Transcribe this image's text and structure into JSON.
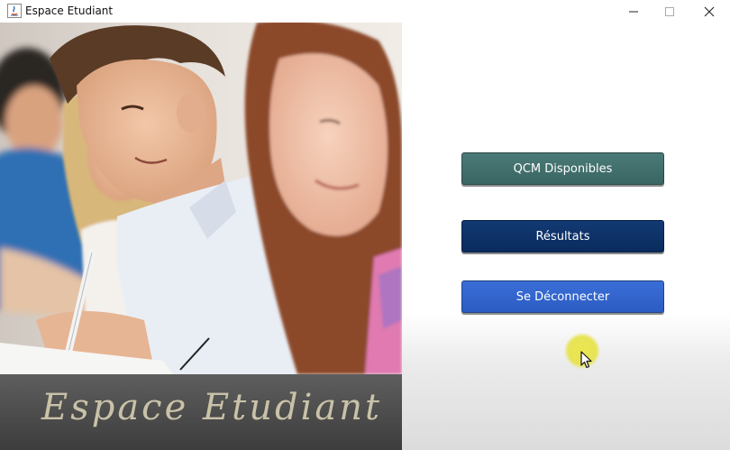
{
  "window": {
    "title": "Espace Etudiant",
    "controls": [
      "minimize-icon",
      "maximize-icon",
      "close-icon"
    ]
  },
  "left_panel": {
    "banner_text": "Espace Etudiant"
  },
  "menu": {
    "qcm_label": "QCM Disponibles",
    "results_label": "Résultats",
    "logout_label": "Se Déconnecter"
  },
  "colors": {
    "qcm_button": "#3f6f6c",
    "results_button": "#0d3166",
    "logout_button": "#3366cc",
    "banner_text": "#c9c2a8",
    "cursor_highlight": "#e8e446"
  }
}
